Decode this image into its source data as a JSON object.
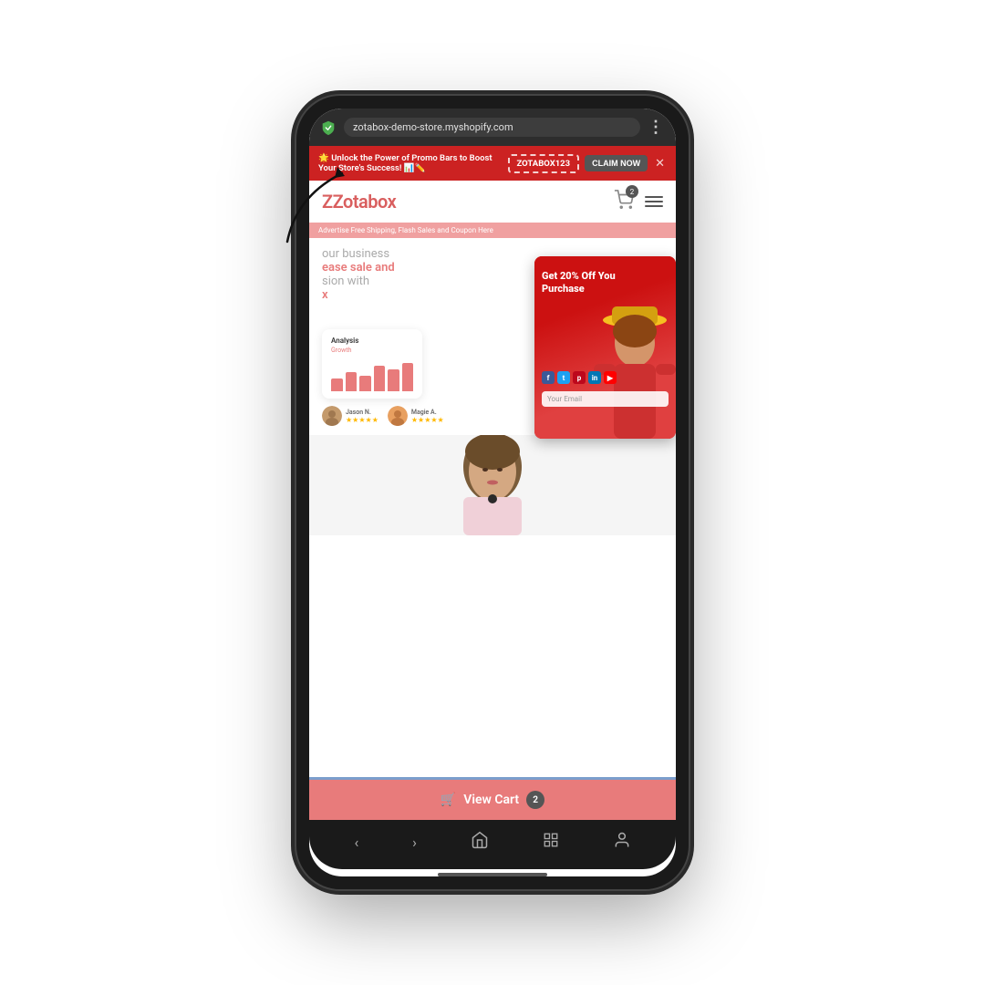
{
  "browser": {
    "url": "zotabox-demo-store.myshopify.com",
    "shield_color": "#4CAF50"
  },
  "promo_bar": {
    "text": "🌟 Unlock the Power of Promo Bars to Boost Your Store's Success! 📊✏️",
    "code": "ZOTABOX123",
    "cta_label": "CLAIM NOW",
    "close_label": "✕"
  },
  "store_nav": {
    "logo": "Zotabox",
    "cart_count": "2",
    "menu_label": "☰"
  },
  "ticker": {
    "text": "Advertise Free Shipping, Flash Sales and Coupon Here"
  },
  "hero": {
    "line1": "our business",
    "line2": "ease sale and",
    "line3": "sion with",
    "line4": "x"
  },
  "analysis_card": {
    "title": "Analysis",
    "subtitle": "Growth",
    "bars": [
      0.4,
      0.6,
      0.5,
      0.8,
      0.7,
      0.9
    ]
  },
  "popup": {
    "offer_line1": "Get 20% Off You",
    "offer_line2": "Purchase",
    "email_placeholder": "Your Email",
    "social_icons": [
      {
        "label": "f",
        "color": "#3b5998"
      },
      {
        "label": "t",
        "color": "#1da1f2"
      },
      {
        "label": "p",
        "color": "#bd081c"
      },
      {
        "label": "in",
        "color": "#0077b5"
      },
      {
        "label": "▶",
        "color": "#ff0000"
      }
    ]
  },
  "reviews": [
    {
      "name": "Jason N.",
      "stars": "★★★★★",
      "avatar_color": "#c49a6c"
    },
    {
      "name": "Magie A.",
      "stars": "★★★★★",
      "avatar_color": "#e8a060"
    }
  ],
  "cart_bar": {
    "label": "View Cart",
    "count": "2",
    "cart_icon": "🛒"
  },
  "android_nav": {
    "back": "‹",
    "forward": "›",
    "home": "⌂",
    "tabs": "⧉",
    "profile": "👤"
  }
}
